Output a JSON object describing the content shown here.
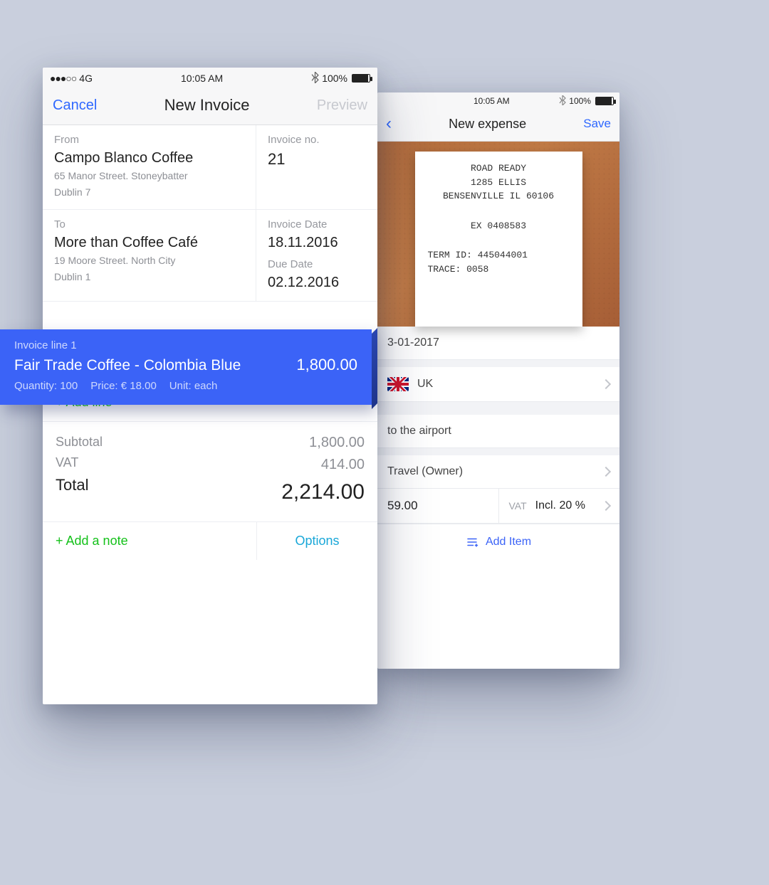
{
  "status": {
    "carrier_dots": "●●●○○",
    "carrier": "4G",
    "time": "10:05 AM",
    "bt_icon": "✱",
    "battery": "100%"
  },
  "invoice": {
    "nav": {
      "cancel": "Cancel",
      "title": "New Invoice",
      "preview": "Preview"
    },
    "from": {
      "label": "From",
      "name": "Campo Blanco Coffee",
      "line1": "65 Manor Street. Stoneybatter",
      "line2": "Dublin 7"
    },
    "to": {
      "label": "To",
      "name": "More than Coffee Café",
      "line1": "19 Moore Street. North City",
      "line2": "Dublin 1"
    },
    "number": {
      "label": "Invoice no.",
      "value": "21"
    },
    "date": {
      "label": "Invoice Date",
      "value": "18.11.2016"
    },
    "due": {
      "label": "Due Date",
      "value": "02.12.2016"
    },
    "line": {
      "header": "Invoice line 1",
      "name": "Fair Trade Coffee - Colombia Blue",
      "amount": "1,800.00",
      "qty_label": "Quantity:",
      "qty": "100",
      "price_label": "Price:",
      "price": "€ 18.00",
      "unit_label": "Unit:",
      "unit": "each"
    },
    "add_line": "+ Add line",
    "totals": {
      "subtotal_label": "Subtotal",
      "subtotal": "1,800.00",
      "vat_label": "VAT",
      "vat": "414.00",
      "total_label": "Total",
      "total": "2,214.00"
    },
    "add_note": "+ Add a note",
    "options": "Options"
  },
  "expense": {
    "nav": {
      "back": "‹",
      "title": "New expense",
      "save": "Save"
    },
    "receipt": {
      "l1": "ROAD READY",
      "l2": "1285 ELLIS",
      "l3": "BENSENVILLE IL 60106",
      "l4": "EX 0408583",
      "l5": "TERM ID:  445044001",
      "l6": "TRACE:      0058"
    },
    "date": "3-01-2017",
    "country": "UK",
    "desc": "to the airport",
    "category": "Travel (Owner)",
    "amount": "59.00",
    "vat_label": "VAT",
    "vat_value": "Incl. 20 %",
    "add_item": "Add Item"
  }
}
